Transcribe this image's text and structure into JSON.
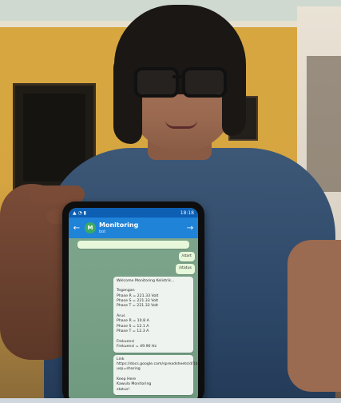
{
  "phone": {
    "status_time": "18:18",
    "status_icons": "▲ ◔ ▮",
    "app_bar": {
      "title": "Monitoring",
      "subtitle": "bot",
      "avatar_letter": "M"
    },
    "messages": [
      {
        "type": "out",
        "text": "/start"
      },
      {
        "type": "out",
        "text": "/status"
      },
      {
        "type": "in",
        "text": "Welcome Monitoring Kelistrik...\n\nTegangan\nPhase R = 221.33 Volt\nPhase S = 221.33 Volt\nPhase T = 221.33 Volt\n\nArus\nPhase R = 10.8 A\nPhase S = 12.1 A\nPhase T = 12.3 A\n\nFrekuensi\nFrekuensi = 49.90 Hz"
      },
      {
        "type": "in",
        "text": "Link\nhttps://docs.google.com/spreadsheets/d/1bLA5Sdg4Y9pb6TKz8tcTh5RkB9fabBUVNkCAHPB/edit?usp=sharing\n\nKeep Here\nKawula Monitoring\nstatus!"
      }
    ]
  },
  "icons": {
    "back": "←",
    "send": "→"
  }
}
